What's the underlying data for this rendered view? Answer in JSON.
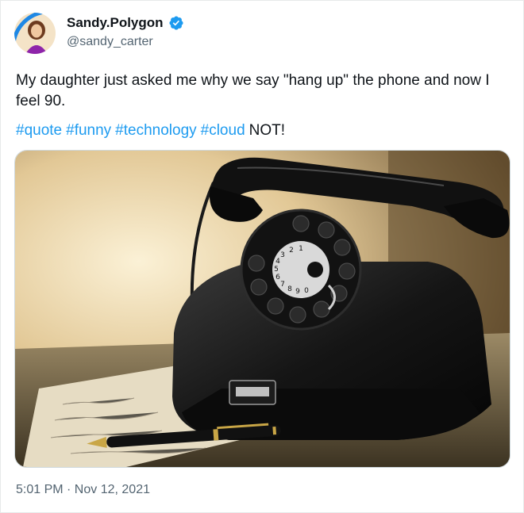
{
  "user": {
    "display_name": "Sandy.Polygon",
    "handle": "@sandy_carter",
    "verified_icon": "verified-badge-icon",
    "verified_color": "#1d9bf0"
  },
  "tweet": {
    "text": "My daughter just asked me why we say \"hang up\" the phone and now I feel 90.",
    "hashtags": [
      "#quote",
      "#funny",
      "#technology",
      "#cloud"
    ],
    "suffix": "NOT!",
    "hashtag_color": "#1d9bf0"
  },
  "media": {
    "dial_digits": [
      "1",
      "2",
      "3",
      "4",
      "5",
      "6",
      "7",
      "8",
      "9",
      "0"
    ]
  },
  "timestamp": "5:01 PM · Nov 12, 2021"
}
